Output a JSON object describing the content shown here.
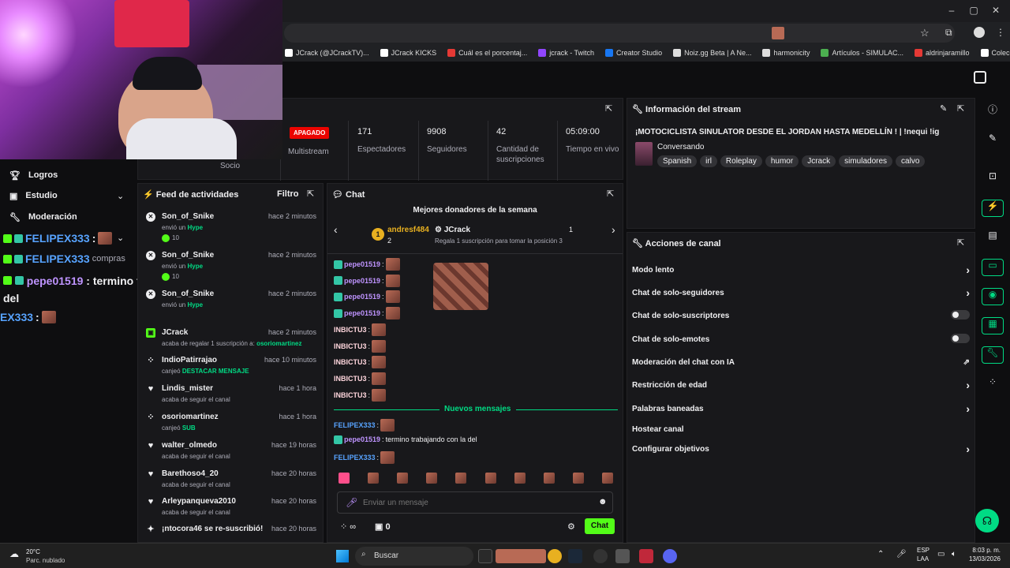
{
  "browser": {
    "bookmarks": [
      "JCrack (@JCrackTV)...",
      "JCrack KICKS",
      "Cuál es el porcentaj...",
      "jcrack - Twitch",
      "Creator Studio",
      "Noiz.gg Beta | A Ne...",
      "harmonicity",
      "Artículos - SIMULAC...",
      "aldrinjaramillo",
      "Colección de M_blei..."
    ],
    "bookmark_colors": [
      "#ffffff",
      "#ffffff",
      "#e53935",
      "#9146ff",
      "#1877f2",
      "#dddddd",
      "#dddddd",
      "#4caf50",
      "#e53935",
      "#ffffff"
    ]
  },
  "sidebar": {
    "items": [
      {
        "label": "Logros",
        "icon": "trophy-icon"
      },
      {
        "label": "Estudio",
        "icon": "video-icon"
      },
      {
        "label": "Moderación",
        "icon": "wrench-icon"
      }
    ]
  },
  "overlay": {
    "line1_name": "FELIPEX333",
    "line1_sep": ":",
    "line2_name": "FELIPEX333",
    "line2_ghost": "compras",
    "line3_name": "pepe01519",
    "line3_sep": ":",
    "line3_text": "termino trabajando con la",
    "line3_cont": "del",
    "line4_name": "EX333",
    "line4_sep": ":"
  },
  "stats": {
    "status": "APAGADO",
    "status_label": "Multistream",
    "socio": "Socio",
    "items": [
      {
        "value": "171",
        "label": "Espectadores"
      },
      {
        "value": "9908",
        "label": "Seguidores"
      },
      {
        "value": "42",
        "label": "Cantidad de suscripciones"
      },
      {
        "value": "05:09:00",
        "label": "Tiempo en vivo"
      }
    ]
  },
  "feed": {
    "title": "Feed de actividades",
    "filter": "Filtro",
    "items": [
      {
        "name": "Son_of_Snike",
        "time": "hace 2 minutos",
        "sub_pre": "envió un",
        "sub_hl": "Hype",
        "extra": "10",
        "icon": "kick-icon"
      },
      {
        "name": "Son_of_Snike",
        "time": "hace 2 minutos",
        "sub_pre": "envió un",
        "sub_hl": "Hype",
        "extra": "10",
        "icon": "kick-icon"
      },
      {
        "name": "Son_of_Snike",
        "time": "hace 2 minutos",
        "sub_pre": "envió un",
        "sub_hl": "Hype",
        "extra": "",
        "icon": "kick-icon"
      },
      {
        "name": "JCrack",
        "time": "hace 2 minutos",
        "sub_pre": "acaba de regalar 1 suscripción a:",
        "sub_hl": "osoriomartinez",
        "extra": "",
        "icon": "gift-icon"
      },
      {
        "name": "IndioPatirrajao",
        "time": "hace 10 minutos",
        "sub_pre": "canjeó",
        "sub_hl": "DESTACAR MENSAJE",
        "extra": "",
        "icon": "points-icon"
      },
      {
        "name": "Lindis_mister",
        "time": "hace 1 hora",
        "sub_pre": "acaba de seguir el canal",
        "sub_hl": "",
        "extra": "",
        "icon": "heart-icon"
      },
      {
        "name": "osoriomartinez",
        "time": "hace 1 hora",
        "sub_pre": "canjeó",
        "sub_hl": "SUB",
        "extra": "",
        "icon": "points-icon"
      },
      {
        "name": "walter_olmedo",
        "time": "hace 19 horas",
        "sub_pre": "acaba de seguir el canal",
        "sub_hl": "",
        "extra": "",
        "icon": "heart-icon"
      },
      {
        "name": "Barethoso4_20",
        "time": "hace 20 horas",
        "sub_pre": "acaba de seguir el canal",
        "sub_hl": "",
        "extra": "",
        "icon": "heart-icon"
      },
      {
        "name": "Arleypanqueva2010",
        "time": "hace 20 horas",
        "sub_pre": "acaba de seguir el canal",
        "sub_hl": "",
        "extra": "",
        "icon": "heart-icon"
      },
      {
        "name": "¡ntocora46 se re-suscribió!",
        "time": "hace 20 horas",
        "sub_pre": "",
        "sub_hl": "",
        "extra": "",
        "icon": "star-icon"
      }
    ]
  },
  "chat": {
    "title": "Chat",
    "top_title": "Mejores donadores de la semana",
    "top1_name": "andresf484",
    "top1_count": "2",
    "top2_name": "JCrack",
    "top2_count": "1",
    "top_hint": "Regala 1 suscripción para tomar la posición 3",
    "lines": [
      {
        "name": "pepe01519",
        "sep": ":",
        "text": ""
      },
      {
        "name": "pepe01519",
        "sep": ":",
        "text": ""
      },
      {
        "name": "pepe01519",
        "sep": ":",
        "text": ""
      },
      {
        "name": "pepe01519",
        "sep": ":",
        "text": ""
      },
      {
        "name": "INBICTU3",
        "sep": ":",
        "text": ""
      },
      {
        "name": "INBICTU3",
        "sep": ":",
        "text": ""
      },
      {
        "name": "INBICTU3",
        "sep": ":",
        "text": ""
      },
      {
        "name": "INBICTU3",
        "sep": ":",
        "text": ""
      },
      {
        "name": "INBICTU3",
        "sep": ":",
        "text": ""
      }
    ],
    "new_label": "Nuevos mensajes",
    "new_lines": [
      {
        "name": "FELIPEX333",
        "sep": ":",
        "text": ""
      },
      {
        "name": "pepe01519",
        "sep": ":",
        "text": "termino trabajando con la del"
      },
      {
        "name": "FELIPEX333",
        "sep": ":",
        "text": ""
      }
    ],
    "placeholder": "Enviar un mensaje",
    "points": "∞",
    "kicks": "0",
    "send": "Chat"
  },
  "info": {
    "title": "Información del stream",
    "stream_title": "¡MOTOCICLISTA SINULATOR DESDE EL JORDAN HASTA MEDELLÍN ! | !nequi !ig",
    "category": "Conversando",
    "tags": [
      "Spanish",
      "irl",
      "Roleplay",
      "humor",
      "Jcrack",
      "simuladores",
      "calvo"
    ]
  },
  "actions": {
    "title": "Acciones de canal",
    "items": [
      {
        "label": "Modo lento",
        "ctrl": "chevron"
      },
      {
        "label": "Chat de solo-seguidores",
        "ctrl": "chevron"
      },
      {
        "label": "Chat de solo-suscriptores",
        "ctrl": "toggle"
      },
      {
        "label": "Chat de solo-emotes",
        "ctrl": "toggle"
      },
      {
        "label": "Moderación del chat con IA",
        "ctrl": "external"
      },
      {
        "label": "Restricción de edad",
        "ctrl": "chevron"
      },
      {
        "label": "Palabras baneadas",
        "ctrl": "chevron"
      },
      {
        "label": "Hostear canal",
        "ctrl": "none"
      },
      {
        "label": "Configurar objetivos",
        "ctrl": "chevron"
      }
    ]
  },
  "taskbar": {
    "weather_temp": "20°C",
    "weather_desc": "Parc. nublado",
    "search": "Buscar",
    "lang1": "ESP",
    "lang2": "LAA",
    "time": "8:03 p. m.",
    "date": "13/03/2026"
  },
  "colors": {
    "accent": "#53fc18",
    "kick_green": "#00db84",
    "status_red": "#eb0400"
  }
}
